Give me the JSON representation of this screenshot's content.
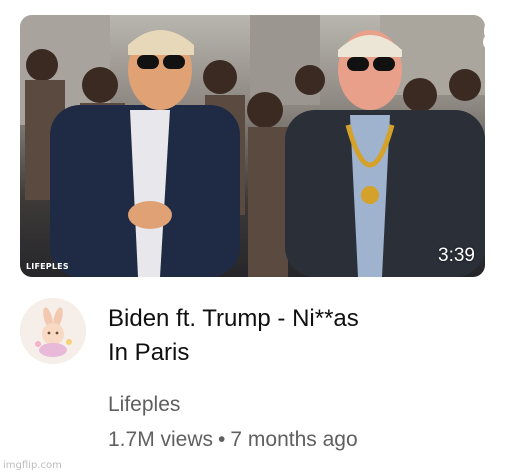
{
  "video": {
    "duration": "3:39",
    "thumbnail_watermark": "LIFEPLES",
    "title_line1": "Biden ft. Trump - Ni**as",
    "title_line2": "In Paris"
  },
  "channel": {
    "name": "Lifeples",
    "avatar_icon": "bunny-mascot-icon"
  },
  "stats": {
    "views": "1.7M views",
    "separator": "•",
    "age": "7 months ago"
  },
  "site_watermark": "imgflip.com"
}
